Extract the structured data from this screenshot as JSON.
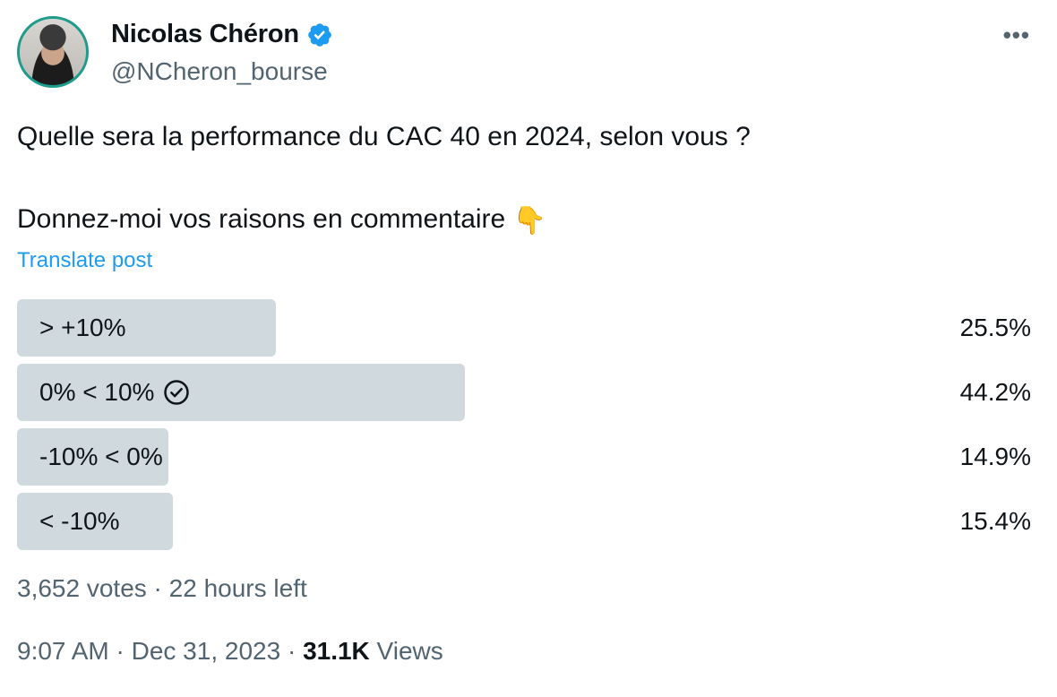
{
  "author": {
    "display_name": "Nicolas Chéron",
    "handle": "@NCheron_bourse",
    "verified_icon": "verified-badge-icon",
    "verified_color": "#1d9bf0"
  },
  "more_label": "•••",
  "tweet": {
    "line1": "Quelle sera la performance du CAC 40 en 2024, selon vous ?",
    "line2": "Donnez-moi vos raisons en commentaire",
    "emoji": "👇"
  },
  "translate_label": "Translate post",
  "poll": {
    "options": [
      {
        "label": "> +10%",
        "percent": "25.5%",
        "fraction": 0.255,
        "selected": false
      },
      {
        "label": "0% < 10%",
        "percent": "44.2%",
        "fraction": 0.442,
        "selected": true
      },
      {
        "label": "-10% < 0%",
        "percent": "14.9%",
        "fraction": 0.149,
        "selected": false
      },
      {
        "label": "< -10%",
        "percent": "15.4%",
        "fraction": 0.154,
        "selected": false
      }
    ],
    "summary": "3,652 votes · 22 hours left"
  },
  "footer": {
    "time": "9:07 AM · Dec 31, 2023 · ",
    "views_count": "31.1K",
    "views_label": " Views"
  },
  "colors": {
    "accent": "#1d9bf0",
    "poll_fill": "#cfd9de",
    "muted_text": "#536471"
  }
}
